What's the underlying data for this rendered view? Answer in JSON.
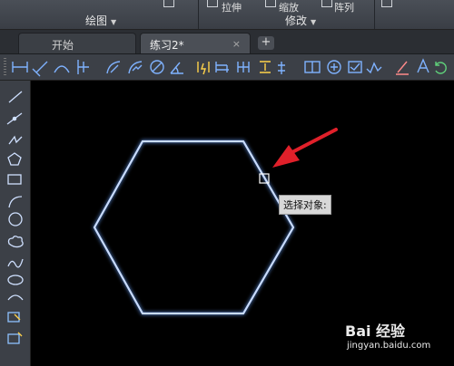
{
  "ribbon": {
    "draw_panel_label": "绘图",
    "modify_panel_label": "修改",
    "stretch_label": "拉伸",
    "scale_label": "缩放",
    "array_label": "阵列"
  },
  "tabs": [
    {
      "label": "开始"
    },
    {
      "label": "练习2*"
    }
  ],
  "tab_close": "×",
  "tab_add": "+",
  "canvas": {
    "tooltip": "选择对象:"
  },
  "watermark": {
    "brand": "Bai 经验",
    "url": "jingyan.baidu.com"
  },
  "colors": {
    "hexagon": "#c9dcff",
    "arrow": "#e0202a",
    "canvas_bg": "#000000",
    "toolbar_bg": "#3c4047"
  },
  "icons": {
    "toolbar": [
      "linear-dim-icon",
      "aligned-dim-icon",
      "arc-length-icon",
      "ordinate-dim-icon",
      "radius-dim-icon",
      "jogged-dim-icon",
      "diameter-dim-icon",
      "angular-dim-icon",
      "quick-dim-icon",
      "baseline-dim-icon",
      "continue-dim-icon",
      "space-dim-icon",
      "break-dim-icon",
      "tolerance-icon",
      "center-mark-icon",
      "inspect-icon",
      "jogged-linear-icon",
      "edit-dim-icon",
      "edit-text-icon",
      "update-dim-icon"
    ],
    "vertical": [
      "line-icon",
      "construction-line-icon",
      "polyline-icon",
      "polygon-icon",
      "rectangle-icon",
      "arc-icon",
      "circle-icon",
      "revision-cloud-icon",
      "spline-icon",
      "ellipse-icon",
      "ellipse-arc-icon",
      "insert-block-icon",
      "make-block-icon"
    ]
  }
}
